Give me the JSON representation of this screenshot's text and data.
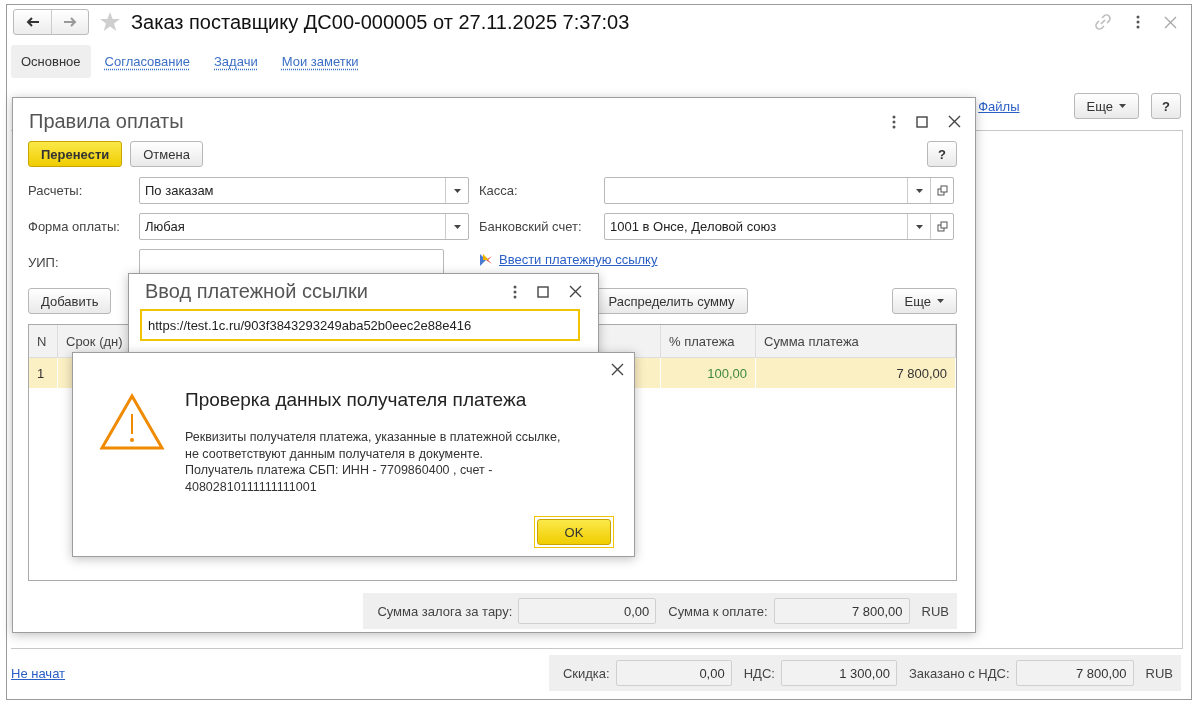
{
  "window": {
    "title": "Заказ поставщику ДС00-000005 от 27.11.2025 7:37:03"
  },
  "tabs": [
    {
      "label": "Основное",
      "selected": true
    },
    {
      "label": "Согласование",
      "selected": false
    },
    {
      "label": "Задачи",
      "selected": false
    },
    {
      "label": "Мои заметки",
      "selected": false
    }
  ],
  "toolbar": {
    "files_link": "Файлы",
    "more_button": "Еще",
    "help_button": "?"
  },
  "status_link": "Не начат",
  "totals": [
    {
      "label": "Скидка:",
      "value": "0,00"
    },
    {
      "label": "НДС:",
      "value": "1 300,00"
    },
    {
      "label": "Заказано с НДС:",
      "value": "7 800,00"
    }
  ],
  "currency": "RUB",
  "payment_rules_dialog": {
    "title": "Правила оплаты",
    "primary_button": "Перенести",
    "cancel_button": "Отмена",
    "help_button": "?",
    "left_fields": [
      {
        "label": "Расчеты:",
        "value": "По заказам",
        "kind": "select"
      },
      {
        "label": "Форма оплаты:",
        "value": "Любая",
        "kind": "select"
      },
      {
        "label": "УИП:",
        "kind": "text"
      }
    ],
    "right_fields": [
      {
        "label": "Касса:",
        "kind": "select_open"
      },
      {
        "label": "Банковский счет:",
        "value": "1001 в Oнce, Деловой союз",
        "kind": "select_open"
      }
    ],
    "payment_link": "Ввести платежную ссылку",
    "add_button": "Добавить",
    "distribute_button": "Распределить сумму",
    "more_button": "Еще",
    "table": {
      "columns": [
        "N",
        "Срок (дн)",
        "% платежа",
        "Сумма платежа"
      ],
      "rows": [
        {
          "cells": [
            "1",
            "",
            "100,00",
            "7 800,00"
          ],
          "selected": true
        }
      ]
    },
    "totals": [
      {
        "label": "Сумма залога за тару:",
        "value": "0,00"
      },
      {
        "label": "Сумма к оплате:",
        "value": "7 800,00"
      }
    ],
    "currency": "RUB"
  },
  "payment_link_dialog": {
    "title": "Ввод платежной ссылки",
    "value": "https://test.1c.ru/903f3843293249aba52b0eec2e88e416"
  },
  "alert": {
    "title": "Проверка данных получателя платежа",
    "message_lines": [
      "Реквизиты получателя платежа, указанные в платежной ссылке,",
      "не соответствуют данным получателя в документе.",
      "Получатель платежа СБП: ИНН - 7709860400 , счет -",
      "40802810111111111001"
    ],
    "ok_button": "OK"
  }
}
